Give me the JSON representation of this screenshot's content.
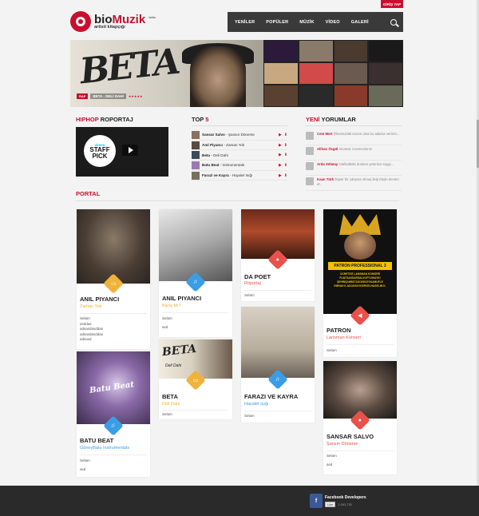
{
  "header": {
    "login_label": "GİRİŞ YAP",
    "logo_bio": "bio",
    "logo_muzik": "Muzik",
    "logo_beta": "beta",
    "logo_tag": "artisti kitapçığı",
    "nav": [
      "YENİLER",
      "POPÜLER",
      "MÜZİK",
      "VİDEO",
      "GALERİ"
    ]
  },
  "banner": {
    "art_text": "BETA",
    "tag": "RAP",
    "caption": "BETA - DELİ DAHİ",
    "stars": "★★★★★"
  },
  "hiphop": {
    "title_red": "HIPHOP",
    "title_black": "ROPORTAJ",
    "video_brand": "vimeo",
    "video_badge": "STAFF PICK"
  },
  "top5": {
    "title_black": "TOP",
    "title_red": "5",
    "items": [
      {
        "artist": "Sansar Salvo",
        "song": "Şansın Dönerse"
      },
      {
        "artist": "Anıl Piyancı",
        "song": "Zaman Yok"
      },
      {
        "artist": "Beta",
        "song": "Deli Dahi"
      },
      {
        "artist": "Batu Beat",
        "song": "Instrumentals"
      },
      {
        "artist": "Farazi ve Kayra",
        "song": "Hayalet Isığı"
      }
    ]
  },
  "comments": {
    "title_red": "YENİ",
    "title_black": "YORUMLAR",
    "items": [
      {
        "name": "Cem Mert",
        "text": "Ölümsüzlük tozum olsa bu adama verirım..."
      },
      {
        "name": "Alihan Özgül",
        "text": "Alcatraz Connections!"
      },
      {
        "name": "Arda Sıtlatay",
        "text": "Harikalttaki dostum yetenice saygı..."
      },
      {
        "name": "Kaan Türk",
        "text": "Süper bir çalışma olmuş ileip böyle devam et."
      }
    ]
  },
  "portal": {
    "title": "PORTAL",
    "cards": [
      {
        "title": "ANIL PIYANCI",
        "subtitle": "Zaman Yok",
        "body": [
          "Selam",
          "asddas",
          "adsasdasddas",
          "adsasdasddas",
          "adsasd"
        ]
      },
      {
        "title": "ANIL PIYANCI",
        "subtitle": "Barış Mı?",
        "body": [
          "Selam",
          "",
          "asd"
        ]
      },
      {
        "title": "DA POET",
        "subtitle": "Röportaj",
        "body": [
          "Selam"
        ]
      },
      {
        "title": "PATRON",
        "subtitle": "Lansman Konseri",
        "body": [
          "Selam"
        ]
      },
      {
        "title": "BATU BEAT",
        "subtitle": "GüneyBatu Instrumentals",
        "body": [
          "Selam",
          "",
          "asd"
        ]
      },
      {
        "title": "BETA",
        "subtitle": "Deli Dahi",
        "body": [
          "Selam"
        ]
      },
      {
        "title": "FARAZI VE KAYRA",
        "subtitle": "Hayalet Işığı",
        "body": [
          "Selam"
        ]
      },
      {
        "title": "SANSAR SALVO",
        "subtitle": "Şansın Dönerse",
        "body": [
          "Selam",
          "",
          "asd"
        ]
      }
    ],
    "poster_title": "PATRON PROFESSIONAL 3",
    "poster_lines": [
      "ÜCRETSİZ LANSMAN KONSERİ",
      "FUATSANSARSALVOFT10HAYKI",
      "ŞEHİNŞAHBETASOKRATSKAMUFLE",
      "EMRAH K.ADOSSKVGERVELHASELIM K."
    ],
    "album_art_text": "Deli Dahi",
    "batu_art_text": "Batu Beat"
  },
  "footer": {
    "fb_name": "Facebook Developers",
    "fb_like": "Like",
    "fb_count": "1,041,731"
  }
}
